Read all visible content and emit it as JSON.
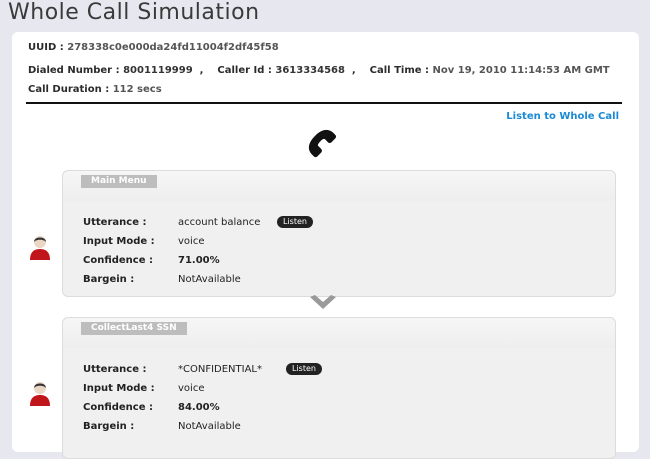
{
  "page": {
    "title": "Whole Call Simulation"
  },
  "call": {
    "uuid_label": "UUID :",
    "uuid": "278338c0e000da24fd11004f2df45f58",
    "dialed_label": "Dialed Number :",
    "dialed": "8001119999",
    "caller_label": "Caller Id :",
    "caller": "3613334568",
    "calltime_label": "Call Time :",
    "calltime": "Nov 19, 2010 11:14:53 AM GMT",
    "duration_label": "Call Duration :",
    "duration": "112 secs",
    "listen_whole": "Listen to Whole Call"
  },
  "labels": {
    "utterance": "Utterance :",
    "input_mode": "Input Mode :",
    "confidence": "Confidence :",
    "bargein": "Bargein :",
    "listen": "Listen"
  },
  "steps": [
    {
      "name": "Main Menu",
      "utterance": "account balance",
      "input_mode": "voice",
      "confidence": "71.00%",
      "bargein": "NotAvailable"
    },
    {
      "name": "CollectLast4 SSN",
      "utterance": "*CONFIDENTIAL*",
      "input_mode": "voice",
      "confidence": "84.00%",
      "bargein": "NotAvailable"
    }
  ],
  "icons": {
    "phone": "phone-handset-icon",
    "avatar": "user-avatar-icon",
    "chevron": "chevron-down-icon"
  },
  "colors": {
    "link": "#1a8ad6",
    "tab": "#bdbdbd",
    "avatar_shirt": "#c0151b"
  }
}
